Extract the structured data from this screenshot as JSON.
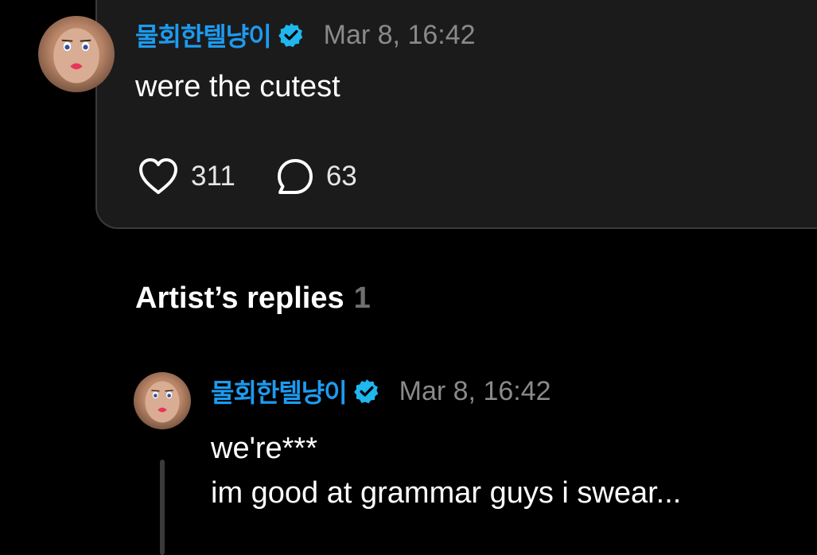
{
  "post": {
    "username": "물회한텔냥이",
    "timestamp": "Mar 8, 16:42",
    "text": "were the cutest",
    "likes": "311",
    "comments": "63"
  },
  "replies_section": {
    "heading": "Artist’s replies",
    "count": "1"
  },
  "reply": {
    "username": "물회한텔냥이",
    "timestamp": "Mar 8, 16:42",
    "line1": "we're***",
    "line2": "im good at grammar guys i swear..."
  },
  "icons": {
    "verified": "verified-badge-icon",
    "like": "heart-outline-icon",
    "comment": "speech-bubble-outline-icon"
  },
  "colors": {
    "background": "#000000",
    "card": "#1b1b1b",
    "username": "#1d9bf0",
    "muted": "#8a8a8a"
  }
}
